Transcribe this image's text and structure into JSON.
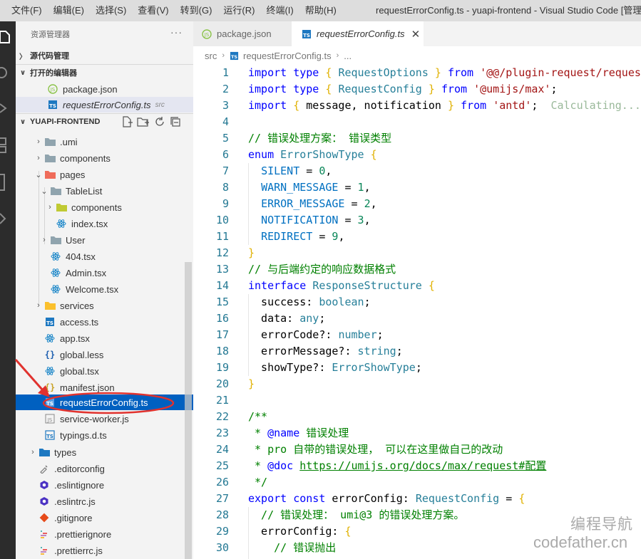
{
  "menu": [
    "文件(F)",
    "编辑(E)",
    "选择(S)",
    "查看(V)",
    "转到(G)",
    "运行(R)",
    "终端(I)",
    "帮助(H)"
  ],
  "window_title": "requestErrorConfig.ts - yuapi-frontend - Visual Studio Code [管理员",
  "sidebar": {
    "header": "资源管理器",
    "more": "···",
    "source_control": "源代码管理",
    "open_editors": "打开的编辑器",
    "open_files": [
      {
        "name": "package.json",
        "dir": ""
      },
      {
        "name": "requestErrorConfig.ts",
        "dir": "src"
      }
    ],
    "project": "YUAPI-FRONTEND",
    "tree": [
      {
        "label": ".umi",
        "icon": "folder-icon"
      },
      {
        "label": "components",
        "icon": "folder-icon"
      },
      {
        "label": "pages",
        "icon": "pages-folder-icon"
      },
      {
        "label": "TableList",
        "icon": "folder-icon"
      },
      {
        "label": "components",
        "icon": "components-folder-icon"
      },
      {
        "label": "index.tsx",
        "icon": "react-icon"
      },
      {
        "label": "User",
        "icon": "folder-icon"
      },
      {
        "label": "404.tsx",
        "icon": "react-icon"
      },
      {
        "label": "Admin.tsx",
        "icon": "react-icon"
      },
      {
        "label": "Welcome.tsx",
        "icon": "react-icon"
      },
      {
        "label": "services",
        "icon": "services-folder-icon"
      },
      {
        "label": "access.ts",
        "icon": "ts-icon"
      },
      {
        "label": "app.tsx",
        "icon": "react-icon"
      },
      {
        "label": "global.less",
        "icon": "less-icon"
      },
      {
        "label": "global.tsx",
        "icon": "react-icon"
      },
      {
        "label": "manifest.json",
        "icon": "json-icon"
      },
      {
        "label": "requestErrorConfig.ts",
        "icon": "ts-icon"
      },
      {
        "label": "service-worker.js",
        "icon": "js-icon"
      },
      {
        "label": "typings.d.ts",
        "icon": "ts-icon"
      },
      {
        "label": "types",
        "icon": "types-folder-icon"
      },
      {
        "label": ".editorconfig",
        "icon": "editorconfig-icon"
      },
      {
        "label": ".eslintignore",
        "icon": "eslint-icon"
      },
      {
        "label": ".eslintrc.js",
        "icon": "eslint-icon"
      },
      {
        "label": ".gitignore",
        "icon": "git-icon"
      },
      {
        "label": ".prettierignore",
        "icon": "prettier-icon"
      },
      {
        "label": ".prettierrc.js",
        "icon": "prettier-icon"
      }
    ]
  },
  "tabs": [
    {
      "label": "package.json"
    },
    {
      "label": "requestErrorConfig.ts"
    }
  ],
  "breadcrumb": [
    "src",
    "requestErrorConfig.ts",
    "..."
  ],
  "code_lines": [
    "import type { RequestOptions } from '@@/plugin-request/reques",
    "import type { RequestConfig } from '@umijs/max';",
    "import { message, notification } from 'antd';  Calculating...",
    "",
    "// 错误处理方案： 错误类型",
    "enum ErrorShowType {",
    "  SILENT = 0,",
    "  WARN_MESSAGE = 1,",
    "  ERROR_MESSAGE = 2,",
    "  NOTIFICATION = 3,",
    "  REDIRECT = 9,",
    "}",
    "// 与后端约定的响应数据格式",
    "interface ResponseStructure {",
    "  success: boolean;",
    "  data: any;",
    "  errorCode?: number;",
    "  errorMessage?: string;",
    "  showType?: ErrorShowType;",
    "}",
    "",
    "/**",
    " * @name 错误处理",
    " * pro 自带的错误处理， 可以在这里做自己的改动",
    " * @doc https://umijs.org/docs/max/request#配置",
    " */",
    "export const errorConfig: RequestConfig = {",
    "  // 错误处理： umi@3 的错误处理方案。",
    "  errorConfig: {",
    "    // 错误抛出"
  ],
  "watermark": {
    "line1": "编程导航",
    "line2": "codefather.cn"
  },
  "colors": {
    "selection": "#0060c0",
    "annotation": "#e0322e",
    "keyword": "#0000ff",
    "string": "#a31515",
    "comment": "#008000"
  }
}
